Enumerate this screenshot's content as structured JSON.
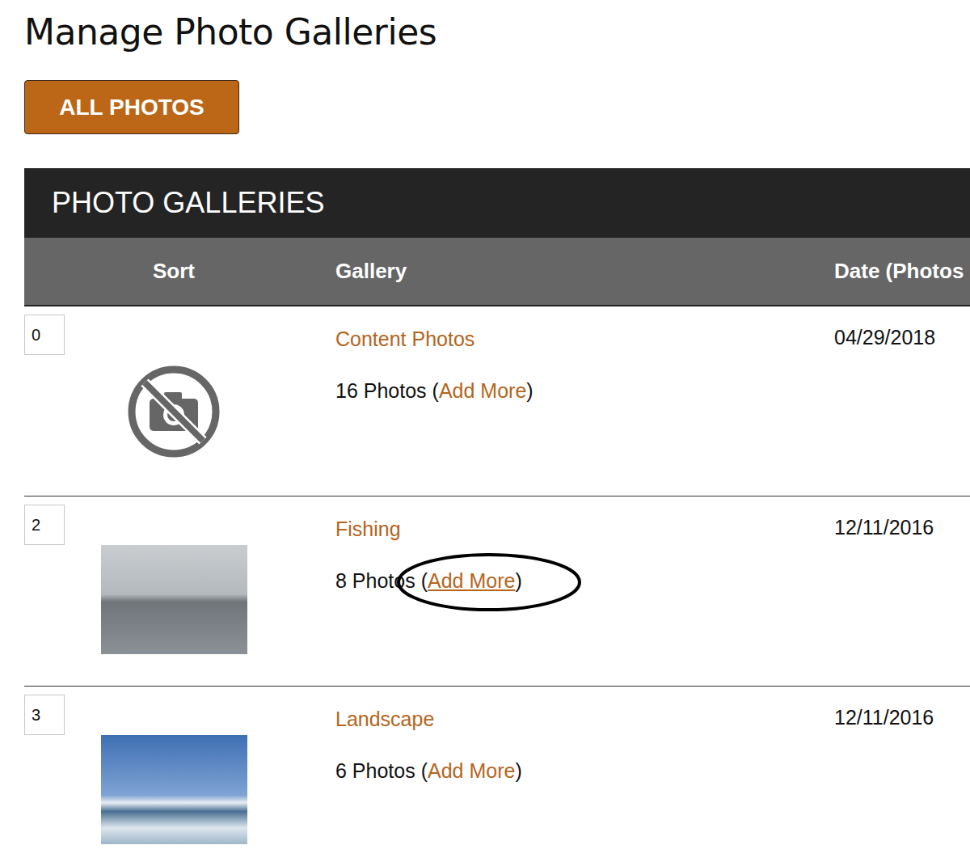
{
  "page": {
    "title": "Manage Photo Galleries",
    "button": "ALL PHOTOS"
  },
  "panel": {
    "title": "PHOTO GALLERIES",
    "columns": [
      "Sort",
      "Gallery",
      "Date (Photos"
    ]
  },
  "rows": [
    {
      "sort": "0",
      "kind": "placeholder",
      "name": "Content Photos",
      "count": "16 Photos",
      "open": "(",
      "link": "Add More",
      "close": ")",
      "date": "04/29/2018",
      "highlighted": false
    },
    {
      "sort": "2",
      "kind": "fishing",
      "name": "Fishing",
      "count": "8 Photos",
      "open": "(",
      "link": "Add More",
      "close": ")",
      "date": "12/11/2016",
      "highlighted": true
    },
    {
      "sort": "3",
      "kind": "landscape",
      "name": "Landscape",
      "count": "6 Photos",
      "open": "(",
      "link": "Add More",
      "close": ")",
      "date": "12/11/2016",
      "highlighted": false
    }
  ]
}
